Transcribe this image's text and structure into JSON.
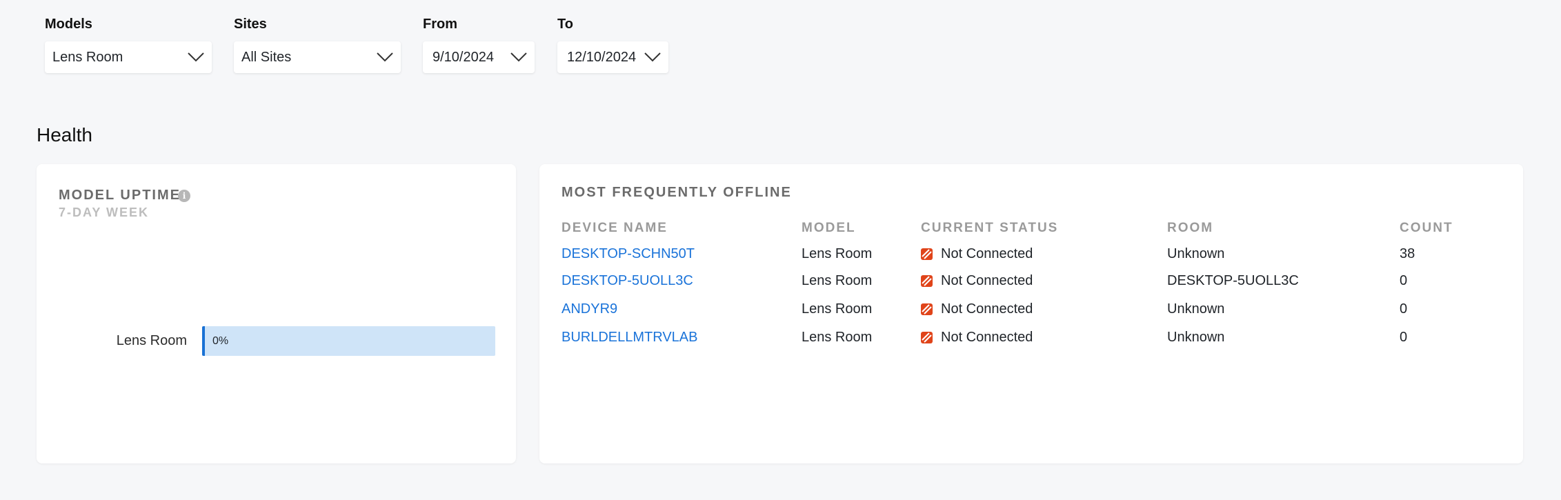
{
  "filters": {
    "models": {
      "label": "Models",
      "value": "Lens Room"
    },
    "sites": {
      "label": "Sites",
      "value": "All Sites"
    },
    "from": {
      "label": "From",
      "value": "9/10/2024"
    },
    "to": {
      "label": "To",
      "value": "12/10/2024"
    }
  },
  "health": {
    "title": "Health",
    "uptime": {
      "title": "MODEL UPTIME",
      "subtitle": "7-DAY WEEK",
      "info_icon": "info-icon",
      "bars": [
        {
          "label": "Lens Room",
          "value": 0,
          "value_text": "0%"
        }
      ]
    },
    "offline": {
      "title": "MOST FREQUENTLY OFFLINE",
      "columns": [
        "DEVICE NAME",
        "MODEL",
        "CURRENT STATUS",
        "ROOM",
        "COUNT"
      ],
      "rows": [
        {
          "device": "DESKTOP-SCHN50T",
          "model": "Lens Room",
          "status": "Not Connected",
          "room": "Unknown",
          "count": "38"
        },
        {
          "device": "DESKTOP-5UOLL3C",
          "model": "Lens Room",
          "status": "Not Connected",
          "room": "DESKTOP-5UOLL3C",
          "count": "0"
        },
        {
          "device": "ANDYR9",
          "model": "Lens Room",
          "status": "Not Connected",
          "room": "Unknown",
          "count": "0"
        },
        {
          "device": "BURLDELLMTRVLAB",
          "model": "Lens Room",
          "status": "Not Connected",
          "room": "Unknown",
          "count": "0"
        }
      ],
      "status_icon": "not-connected-icon"
    }
  },
  "colors": {
    "link": "#1a73d9",
    "bar_track": "#cfe4f8",
    "bar_accent": "#1971d4",
    "status_error": "#e0441a"
  }
}
